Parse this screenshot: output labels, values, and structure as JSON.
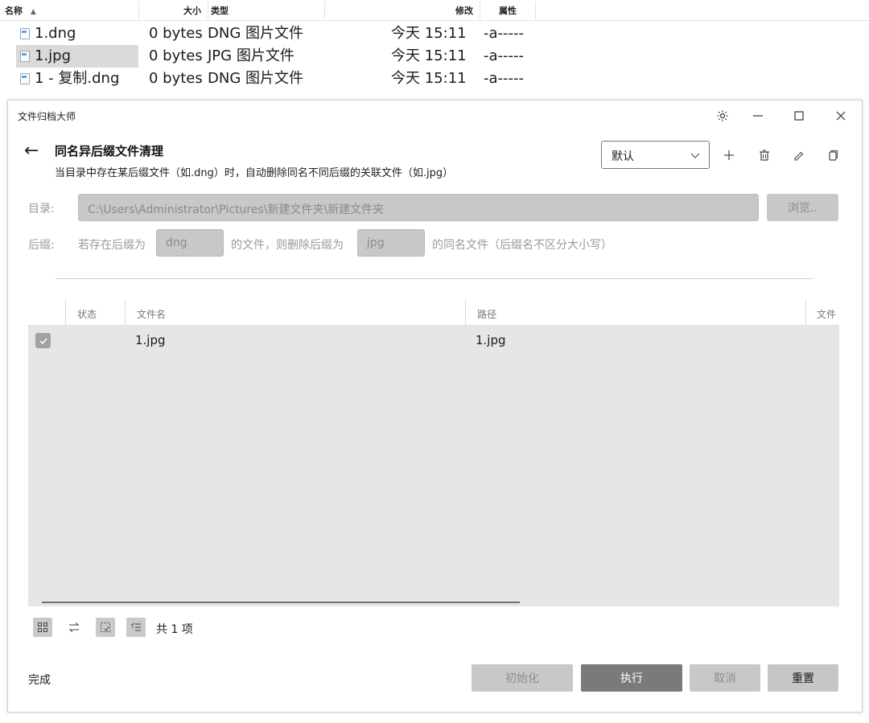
{
  "explorer": {
    "columns": {
      "name": "名称",
      "size": "大小",
      "type": "类型",
      "modified": "修改",
      "attributes": "属性"
    },
    "rows": [
      {
        "name": "1.dng",
        "size": "0 bytes",
        "type": "DNG 图片文件",
        "modified": "今天 15:11",
        "attr": "-a-----"
      },
      {
        "name": "1.jpg",
        "size": "0 bytes",
        "type": "JPG 图片文件",
        "modified": "今天 15:11",
        "attr": "-a-----"
      },
      {
        "name": "1 - 复制.dng",
        "size": "0 bytes",
        "type": "DNG 图片文件",
        "modified": "今天 15:11",
        "attr": "-a-----"
      }
    ]
  },
  "app": {
    "window_title": "文件归档大师",
    "page_title": "同名异后缀文件清理",
    "page_subtitle": "当目录中存在某后缀文件（如.dng）时，自动删除同名不同后缀的关联文件（如.jpg）",
    "preset": "默认",
    "directory_label": "目录:",
    "directory_value": "C:\\Users\\Administrator\\Pictures\\新建文件夹\\新建文件夹",
    "browse_label": "浏览..",
    "suffix_label": "后缀:",
    "suffix_text1": "若存在后缀为",
    "suffix_keep": "dng",
    "suffix_text2": "的文件，则删除后缀为",
    "suffix_delete": "jpg",
    "suffix_text3": "的同名文件（后缀名不区分大小写）",
    "grid": {
      "headers": {
        "status": "状态",
        "filename": "文件名",
        "path": "路径",
        "extra": "文件"
      },
      "rows": [
        {
          "checked": true,
          "status": "",
          "filename": "1.jpg",
          "path": "1.jpg"
        }
      ]
    },
    "count_text": "共 1 项",
    "status_text": "完成",
    "buttons": {
      "init": "初始化",
      "execute": "执行",
      "cancel": "取消",
      "reset": "重置"
    }
  }
}
